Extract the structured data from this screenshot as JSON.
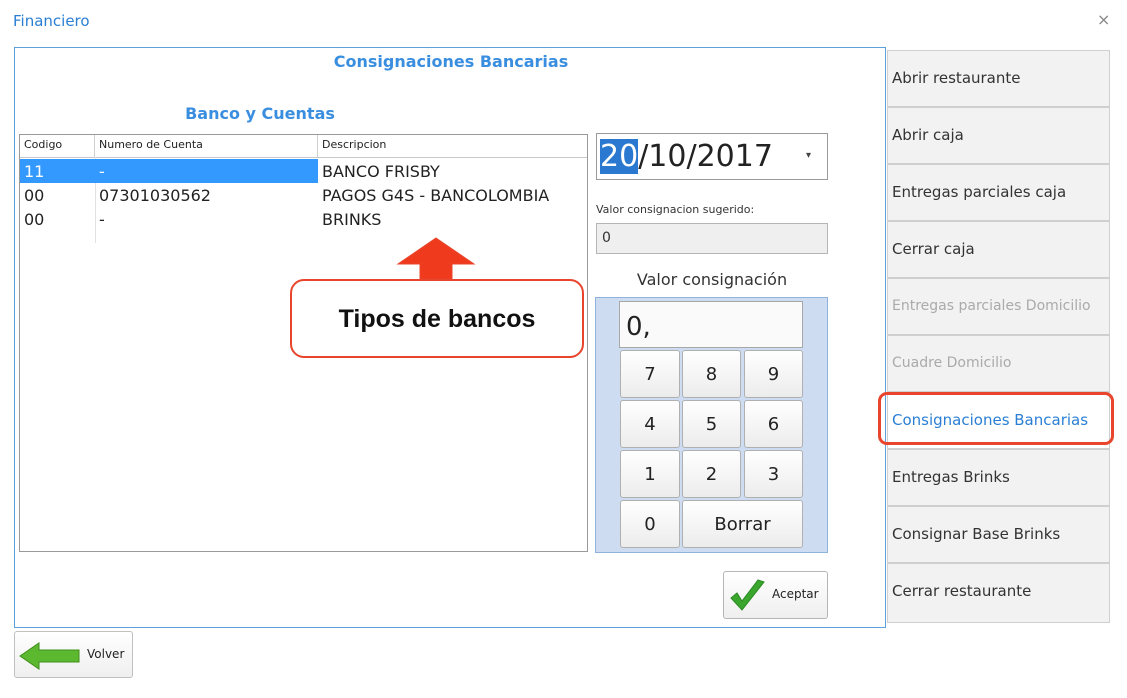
{
  "window": {
    "title": "Financiero",
    "close_symbol": "×"
  },
  "panel": {
    "title": "Consignaciones Bancarias"
  },
  "bank_section": {
    "title": "Banco y Cuentas",
    "columns": [
      "Codigo",
      "Numero de Cuenta",
      "Descripcion"
    ],
    "rows": [
      {
        "codigo": "11",
        "cuenta": "-",
        "descripcion": "BANCO FRISBY",
        "selected": true
      },
      {
        "codigo": "00",
        "cuenta": "07301030562",
        "descripcion": "PAGOS G4S - BANCOLOMBIA",
        "selected": false
      },
      {
        "codigo": "00",
        "cuenta": "-",
        "descripcion": "BRINKS",
        "selected": false
      }
    ]
  },
  "date": {
    "day": "20",
    "rest": "/10/2017",
    "arrow": "▾"
  },
  "suggested": {
    "label": "Valor consignacion sugerido:",
    "value": "0"
  },
  "amount": {
    "label": "Valor consignación",
    "display": "0,",
    "keys": [
      "7",
      "8",
      "9",
      "4",
      "5",
      "6",
      "1",
      "2",
      "3",
      "0"
    ],
    "delete_label": "Borrar"
  },
  "accept_button": {
    "label": "Aceptar",
    "icon": "checkmark-icon",
    "color": "#3aa62e"
  },
  "back_button": {
    "label": "Volver",
    "icon": "arrow-left-icon",
    "color": "#5cb82e"
  },
  "side_menu": [
    {
      "label": "Abrir restaurante",
      "state": "enabled"
    },
    {
      "label": "Abrir caja",
      "state": "enabled"
    },
    {
      "label": "Entregas parciales caja",
      "state": "enabled"
    },
    {
      "label": "Cerrar caja",
      "state": "enabled"
    },
    {
      "label": "Entregas parciales Domicilio",
      "state": "disabled"
    },
    {
      "label": "Cuadre Domicilio",
      "state": "disabled"
    },
    {
      "label": "Consignaciones Bancarias",
      "state": "active"
    },
    {
      "label": "Entregas Brinks",
      "state": "enabled"
    },
    {
      "label": "Consignar Base Brinks",
      "state": "enabled"
    },
    {
      "label": "Cerrar restaurante",
      "state": "enabled"
    }
  ],
  "annotation": {
    "callout": "Tipos de bancos",
    "color": "#e8452c"
  },
  "colors": {
    "accent": "#2a7fd4",
    "selection": "#3399ff",
    "keypad_bg": "#cddcf0"
  }
}
